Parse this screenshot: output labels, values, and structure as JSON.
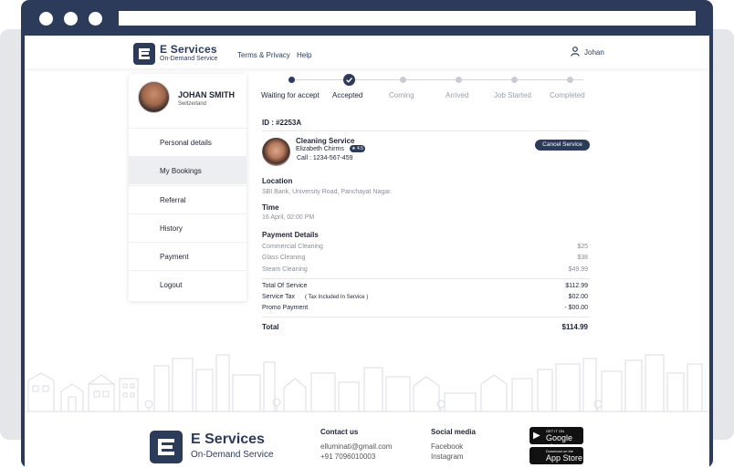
{
  "header": {
    "brand_title": "E Services",
    "brand_sub": "On-Demand Service",
    "nav": [
      "Terms & Privacy",
      "Help"
    ],
    "user": "Johan"
  },
  "profile": {
    "name": "JOHAN SMITH",
    "country": "Switzerland"
  },
  "sidebar": {
    "items": [
      {
        "label": "Personal details"
      },
      {
        "label": "My Bookings"
      },
      {
        "label": "Referral"
      },
      {
        "label": "History"
      },
      {
        "label": "Payment"
      },
      {
        "label": "Logout"
      }
    ],
    "active": "My Bookings"
  },
  "steps": [
    {
      "label": "Waiting for accept"
    },
    {
      "label": "Accepted"
    },
    {
      "label": "Coming"
    },
    {
      "label": "Arrived"
    },
    {
      "label": "Job Started"
    },
    {
      "label": "Completed"
    }
  ],
  "booking": {
    "id": "ID : #2253A",
    "service": "Cleaning Service",
    "worker": "Elizabeth Chirms",
    "rating": "4.5",
    "call": "Call : 1234-567-459",
    "cancel_label": "Cancel Service",
    "location_label": "Location",
    "location": "SBI Bank, University Road, Panchayat Nagar.",
    "time_label": "Time",
    "time": "16 April, 02:00 PM",
    "payment_label": "Payment Details",
    "items": [
      {
        "name": "Commercial Cleaning",
        "price": "$25"
      },
      {
        "name": "Glass Cleaning",
        "price": "$38"
      },
      {
        "name": "Steam Cleaning",
        "price": "$49.99"
      }
    ],
    "total_of_service_label": "Total Of Service",
    "total_of_service": "$112.99",
    "service_tax_label": "Service Tax",
    "service_tax_note": "( Tax Included In Service )",
    "service_tax": "$02.00",
    "promo_label": "Promo Payment",
    "promo": "- $00.00",
    "total_label": "Total",
    "total": "$114.99"
  },
  "footer": {
    "brand_title": "E Services",
    "brand_sub": "On-Demand Service",
    "contact_title": "Contact us",
    "email": "elluminati@gmail.com",
    "phone": "+91 7096010003",
    "social_title": "Social media",
    "social": [
      "Facebook",
      "Instagram"
    ],
    "play_small": "GET IT ON",
    "play_big": "Google play",
    "apple_small": "Download on the",
    "apple_big": "App Store"
  },
  "colors": {
    "brand": "#2d3b5a",
    "window": "#2d3b5a",
    "muted": "#8a8f98"
  },
  "icons": [
    "user-icon",
    "check-icon",
    "star-icon",
    "play-icon",
    "apple-icon"
  ]
}
